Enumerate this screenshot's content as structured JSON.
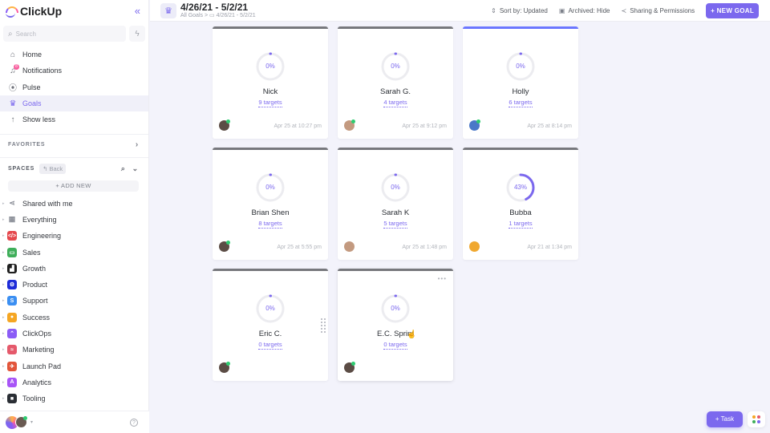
{
  "app": {
    "name": "ClickUp"
  },
  "sidebar": {
    "search_placeholder": "Search",
    "nav": [
      {
        "label": "Home",
        "icon": "home-icon"
      },
      {
        "label": "Notifications",
        "icon": "bell-icon",
        "badge": "8"
      },
      {
        "label": "Pulse",
        "icon": "pulse-icon"
      },
      {
        "label": "Goals",
        "icon": "trophy-icon",
        "active": true
      },
      {
        "label": "Show less",
        "icon": "arrow-up-icon"
      }
    ],
    "favorites_label": "FAVORITES",
    "spaces_label": "SPACES",
    "back_label": "Back",
    "add_new_label": "+ ADD NEW",
    "spaces": [
      {
        "label": "Shared with me",
        "icon": "share-icon",
        "color": ""
      },
      {
        "label": "Everything",
        "icon": "grid-icon",
        "color": ""
      },
      {
        "label": "Engineering",
        "icon": "code-icon",
        "color": "#e5484d",
        "glyph": "</>"
      },
      {
        "label": "Sales",
        "icon": "money-icon",
        "color": "#3fae5a",
        "glyph": "▭"
      },
      {
        "label": "Growth",
        "icon": "chart-icon",
        "color": "#1f1f1f",
        "glyph": "▟"
      },
      {
        "label": "Product",
        "icon": "product-icon",
        "color": "#1d2bd8",
        "glyph": "⚙"
      },
      {
        "label": "Support",
        "icon": "support-icon",
        "color": "#3b8ff2",
        "glyph": "S"
      },
      {
        "label": "Success",
        "icon": "success-icon",
        "color": "#f5a623",
        "glyph": "●"
      },
      {
        "label": "ClickOps",
        "icon": "clickops-icon",
        "color": "#8b5cf6",
        "glyph": "⌃"
      },
      {
        "label": "Marketing",
        "icon": "wifi-icon",
        "color": "#e5596b",
        "glyph": "≈"
      },
      {
        "label": "Launch Pad",
        "icon": "plane-icon",
        "color": "#e2553a",
        "glyph": "✈"
      },
      {
        "label": "Analytics",
        "icon": "analytics-icon",
        "color": "#a855f7",
        "glyph": "A"
      },
      {
        "label": "Tooling",
        "icon": "tooling-icon",
        "color": "#2a2e34",
        "glyph": "■"
      }
    ]
  },
  "header": {
    "title": "4/26/21 - 5/2/21",
    "breadcrumb_root": "All Goals",
    "breadcrumb_sep": ">",
    "breadcrumb_folder": "4/26/21 - 5/2/21",
    "sort_label": "Sort by: Updated",
    "archived_label": "Archived: Hide",
    "sharing_label": "Sharing & Permissions",
    "new_goal_label": "+ NEW GOAL"
  },
  "goals": [
    {
      "name": "Nick",
      "progress_pct": 0,
      "progress_label": "0%",
      "targets": "9 targets",
      "updated": "Apr 25 at 10:27 pm",
      "color_bar": "#77787d"
    },
    {
      "name": "Sarah G.",
      "progress_pct": 0,
      "progress_label": "0%",
      "targets": "4 targets",
      "updated": "Apr 25 at 9:12 pm",
      "color_bar": "#77787d"
    },
    {
      "name": "Holly",
      "progress_pct": 0,
      "progress_label": "0%",
      "targets": "6 targets",
      "updated": "Apr 25 at 8:14 pm",
      "color_bar": "#6b76ff"
    },
    {
      "name": "Brian Shen",
      "progress_pct": 0,
      "progress_label": "0%",
      "targets": "8 targets",
      "updated": "Apr 25 at 5:55 pm",
      "color_bar": "#77787d"
    },
    {
      "name": "Sarah K",
      "progress_pct": 0,
      "progress_label": "0%",
      "targets": "5 targets",
      "updated": "Apr 25 at 1:48 pm",
      "color_bar": "#77787d"
    },
    {
      "name": "Bubba",
      "progress_pct": 43,
      "progress_label": "43%",
      "targets": "1 targets",
      "updated": "Apr 21 at 1:34 pm",
      "color_bar": "#77787d"
    },
    {
      "name": "Eric C.",
      "progress_pct": 0,
      "progress_label": "0%",
      "targets": "0 targets",
      "updated": "",
      "color_bar": "#77787d"
    },
    {
      "name": "E.C. Sprint",
      "progress_pct": 0,
      "progress_label": "0%",
      "targets": "0 targets",
      "updated": "",
      "color_bar": "#77787d"
    }
  ],
  "floating": {
    "task_label": "+ Task"
  },
  "colors": {
    "accent": "#7b68ee",
    "background": "#f3f3fb"
  }
}
